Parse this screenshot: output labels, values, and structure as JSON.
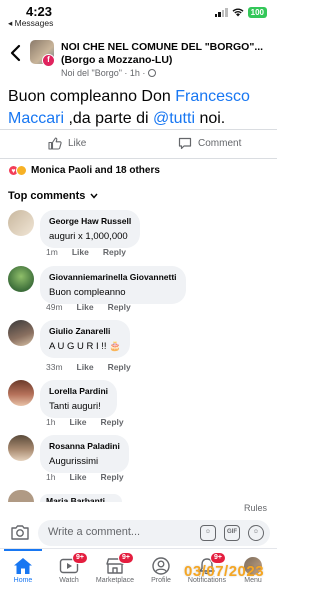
{
  "status_bar": {
    "time": "4:23",
    "back_app": "◂ Messages",
    "battery": "100"
  },
  "header": {
    "group_name": "NOI CHE NEL COMUNE DEL \"BORGO\"...(Borgo a Mozzano-LU)",
    "meta": "Noi del \"Borgo\" · 1h ·"
  },
  "post": {
    "text_before": "Buon compleanno Don ",
    "mention_1": "Francesco Maccari",
    "text_middle": " ,da parte di ",
    "mention_2": "@tutti",
    "text_after": " noi."
  },
  "actions": {
    "like": "Like",
    "comment": "Comment"
  },
  "reactions": {
    "summary": "Monica Paoli and 18 others"
  },
  "top_comments_label": "Top comments",
  "comments": [
    {
      "name": "George Haw Russell",
      "text": "auguri x 1,000,000",
      "time": "1m",
      "like": "Like",
      "reply": "Reply"
    },
    {
      "name": "Giovanniemarinella Giovannetti",
      "text": "Buon compleanno",
      "time": "49m",
      "like": "Like",
      "reply": "Reply"
    },
    {
      "name": "Giulio Zanarelli",
      "text": "A U G U R I !! 🎂",
      "time": "33m",
      "like": "Like",
      "reply": "Reply"
    },
    {
      "name": "Lorella Pardini",
      "text": "Tanti auguri!",
      "time": "1h",
      "like": "Like",
      "reply": "Reply"
    },
    {
      "name": "Rosanna Paladini",
      "text": "Augurissimi",
      "time": "1h",
      "like": "Like",
      "reply": "Reply"
    }
  ],
  "partial_comment_name": "Maria Barbanti",
  "rules_label": "Rules",
  "composer": {
    "placeholder": "Write a comment..."
  },
  "tabs": [
    {
      "label": "Home",
      "badge": ""
    },
    {
      "label": "Watch",
      "badge": "9+"
    },
    {
      "label": "Marketplace",
      "badge": "9+"
    },
    {
      "label": "Profile",
      "badge": ""
    },
    {
      "label": "Notifications",
      "badge": "9+"
    },
    {
      "label": "Menu",
      "badge": ""
    }
  ],
  "watermark": "03/07/2023",
  "colors": {
    "accent": "#1877f2",
    "badge": "#e41e3f",
    "watermark": "#f5a623"
  }
}
